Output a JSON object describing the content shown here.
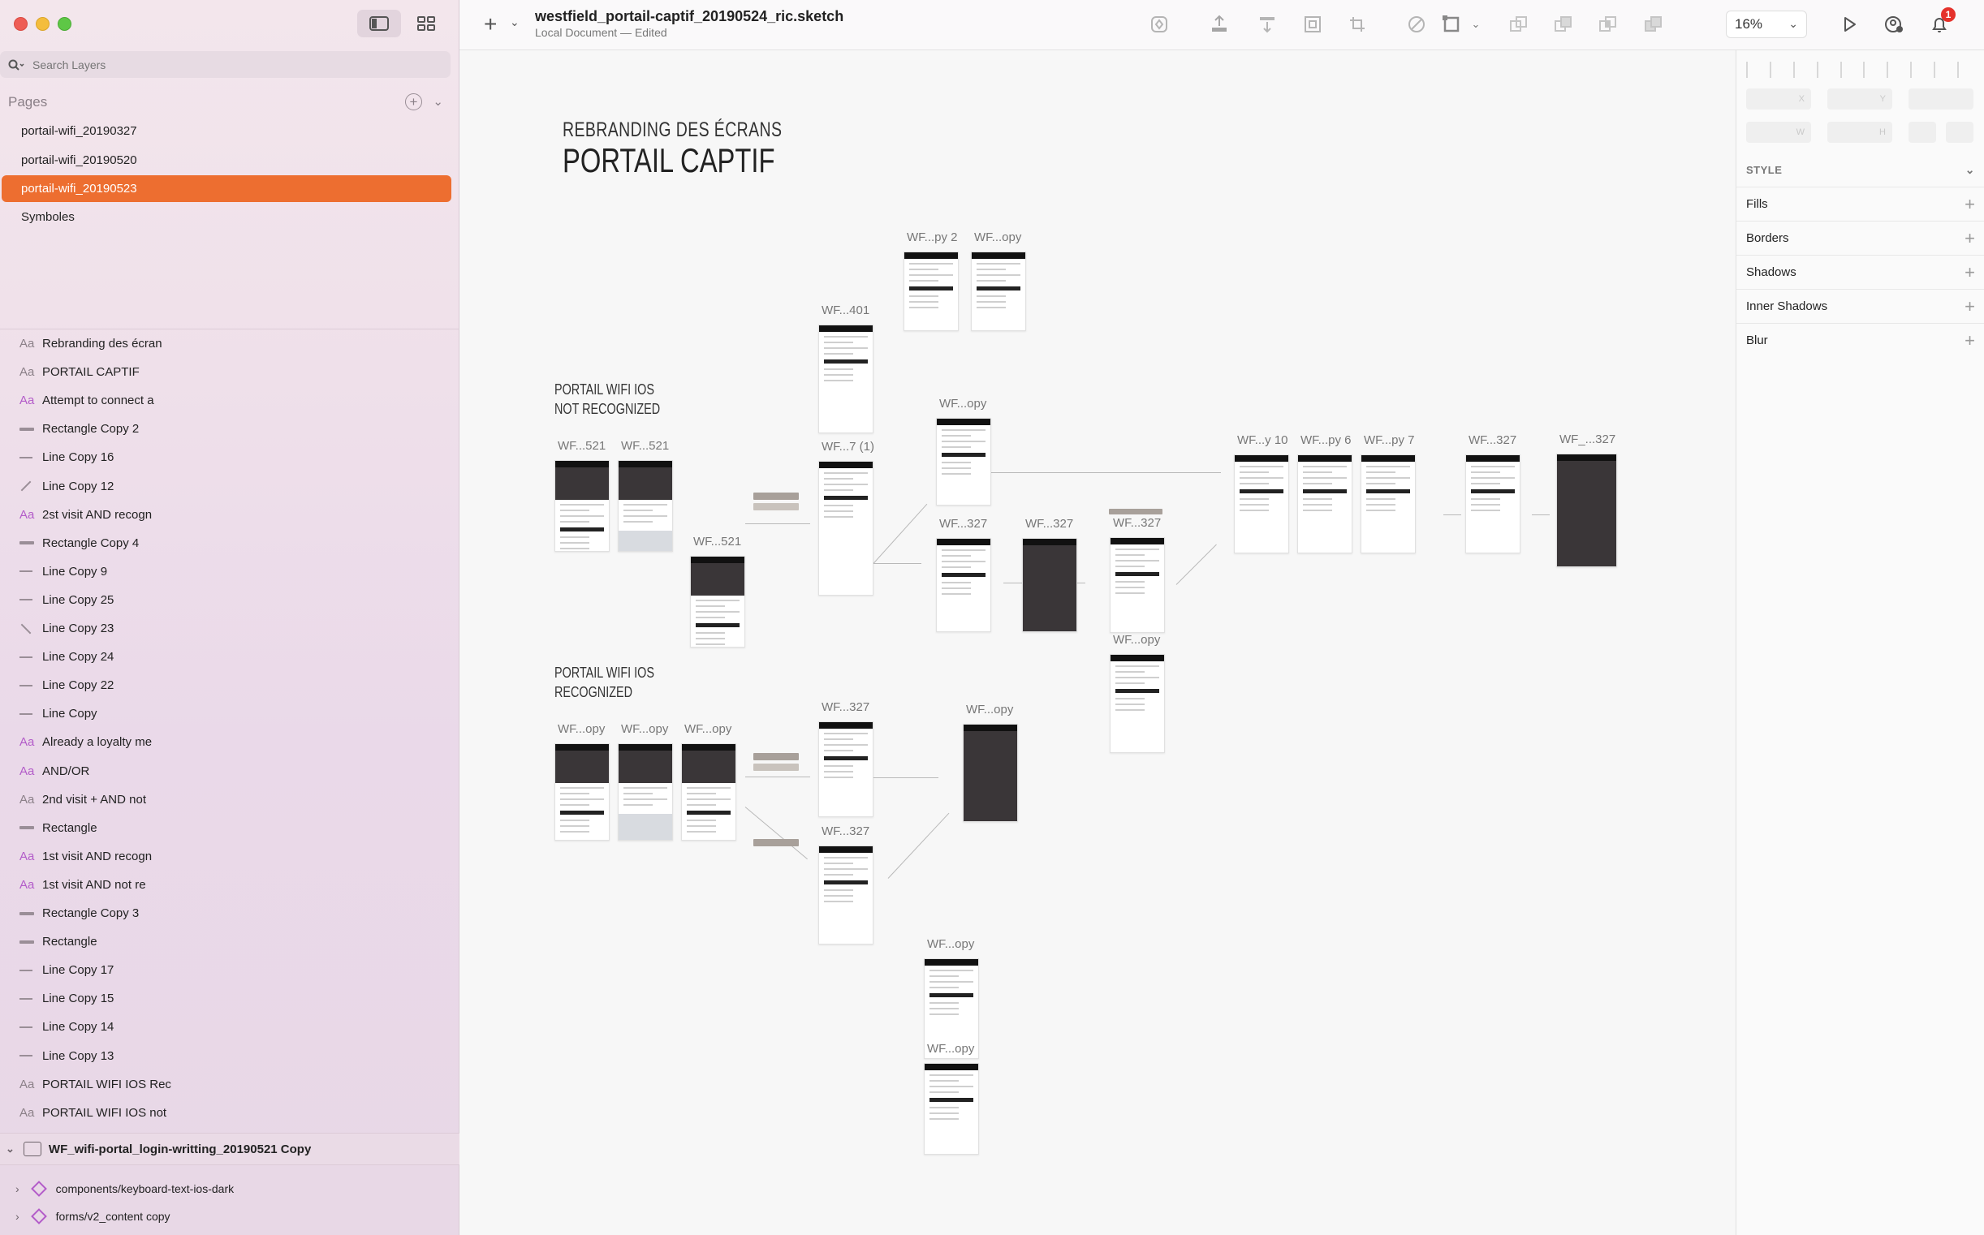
{
  "sidebar": {
    "search_placeholder": "Search Layers",
    "pages_title": "Pages",
    "pages": [
      {
        "label": "portail-wifi_20190327",
        "selected": false
      },
      {
        "label": "portail-wifi_20190520",
        "selected": false
      },
      {
        "label": "portail-wifi_20190523",
        "selected": true
      },
      {
        "label": "Symboles",
        "selected": false
      }
    ],
    "layers": [
      {
        "icon": "text",
        "label": "Rebranding des écran"
      },
      {
        "icon": "text",
        "label": "PORTAIL CAPTIF"
      },
      {
        "icon": "text-pink",
        "label": "Attempt to connect a"
      },
      {
        "icon": "rect",
        "label": "Rectangle Copy 2"
      },
      {
        "icon": "line",
        "label": "Line Copy 16"
      },
      {
        "icon": "slash",
        "label": "Line Copy 12"
      },
      {
        "icon": "text-pink",
        "label": "2st visit AND recogn"
      },
      {
        "icon": "rect",
        "label": "Rectangle Copy 4"
      },
      {
        "icon": "line",
        "label": "Line Copy 9"
      },
      {
        "icon": "line",
        "label": "Line Copy 25"
      },
      {
        "icon": "bslash",
        "label": "Line Copy 23"
      },
      {
        "icon": "line",
        "label": "Line Copy 24"
      },
      {
        "icon": "line",
        "label": "Line Copy 22"
      },
      {
        "icon": "line",
        "label": "Line Copy"
      },
      {
        "icon": "text-pink",
        "label": "Already a loyalty me"
      },
      {
        "icon": "text-pink",
        "label": "AND/OR"
      },
      {
        "icon": "text",
        "label": "2nd visit + AND not"
      },
      {
        "icon": "rect",
        "label": "Rectangle"
      },
      {
        "icon": "text-pink",
        "label": "1st visit AND recogn"
      },
      {
        "icon": "text-pink",
        "label": "1st visit AND not re"
      },
      {
        "icon": "rect",
        "label": "Rectangle Copy 3"
      },
      {
        "icon": "rect",
        "label": "Rectangle"
      },
      {
        "icon": "line",
        "label": "Line Copy 17"
      },
      {
        "icon": "line",
        "label": "Line Copy 15"
      },
      {
        "icon": "line",
        "label": "Line Copy 14"
      },
      {
        "icon": "line",
        "label": "Line Copy 13"
      },
      {
        "icon": "text",
        "label": "PORTAIL WIFI IOS Rec"
      },
      {
        "icon": "text",
        "label": "PORTAIL WIFI IOS not"
      }
    ],
    "group": "WF_wifi-portal_login-writting_20190521 Copy",
    "symbols": [
      "components/keyboard-text-ios-dark",
      "forms/v2_content copy"
    ]
  },
  "toolbar": {
    "doc_title": "westfield_portail-captif_20190524_ric.sketch",
    "doc_subtitle": "Local Document — Edited",
    "zoom": "16%",
    "notification_count": "1",
    "icons": [
      "symbol-icon",
      "export-icon",
      "distribute-icon",
      "mask-icon",
      "scale-icon",
      "edit-path-icon",
      "transform-icon",
      "union-icon",
      "subtract-icon",
      "intersect-icon",
      "difference-icon",
      "preview-icon",
      "cloud-icon",
      "notification-icon"
    ]
  },
  "canvas": {
    "title_small": "REBRANDING DES ÉCRANS",
    "title_big": "PORTAIL CAPTIF",
    "section_not_recognized": "PORTAIL WIFI IOS\nNOT RECOGNIZED",
    "section_recognized": "PORTAIL WIFI IOS\nRECOGNIZED",
    "artboards": [
      {
        "label": "WF...py 2"
      },
      {
        "label": "WF...opy"
      },
      {
        "label": "WF...401"
      },
      {
        "label": "WF...521"
      },
      {
        "label": "WF...521"
      },
      {
        "label": "WF...7 (1)"
      },
      {
        "label": "WF...opy"
      },
      {
        "label": "WF...521"
      },
      {
        "label": "WF...327"
      },
      {
        "label": "WF...327"
      },
      {
        "label": "WF...327"
      },
      {
        "label": "WF...opy"
      },
      {
        "label": "WF...y 10"
      },
      {
        "label": "WF...py 6"
      },
      {
        "label": "WF...py 7"
      },
      {
        "label": "WF...327"
      },
      {
        "label": "WF_...327"
      },
      {
        "label": "WF...opy"
      },
      {
        "label": "WF...opy"
      },
      {
        "label": "WF...opy"
      },
      {
        "label": "WF...327"
      },
      {
        "label": "WF...opy"
      },
      {
        "label": "WF...327"
      },
      {
        "label": "WF...opy"
      },
      {
        "label": "WF...opy"
      }
    ]
  },
  "inspector": {
    "field_labels": [
      "X",
      "Y",
      "",
      "W",
      "H"
    ],
    "style_title": "STYLE",
    "rows": [
      "Fills",
      "Borders",
      "Shadows",
      "Inner Shadows",
      "Blur"
    ]
  },
  "colors": {
    "accent": "#ed6e30",
    "sidebar_bg": "#efe0ea",
    "canvas_bg": "#f7f7f7",
    "badge": "#e5322b"
  }
}
